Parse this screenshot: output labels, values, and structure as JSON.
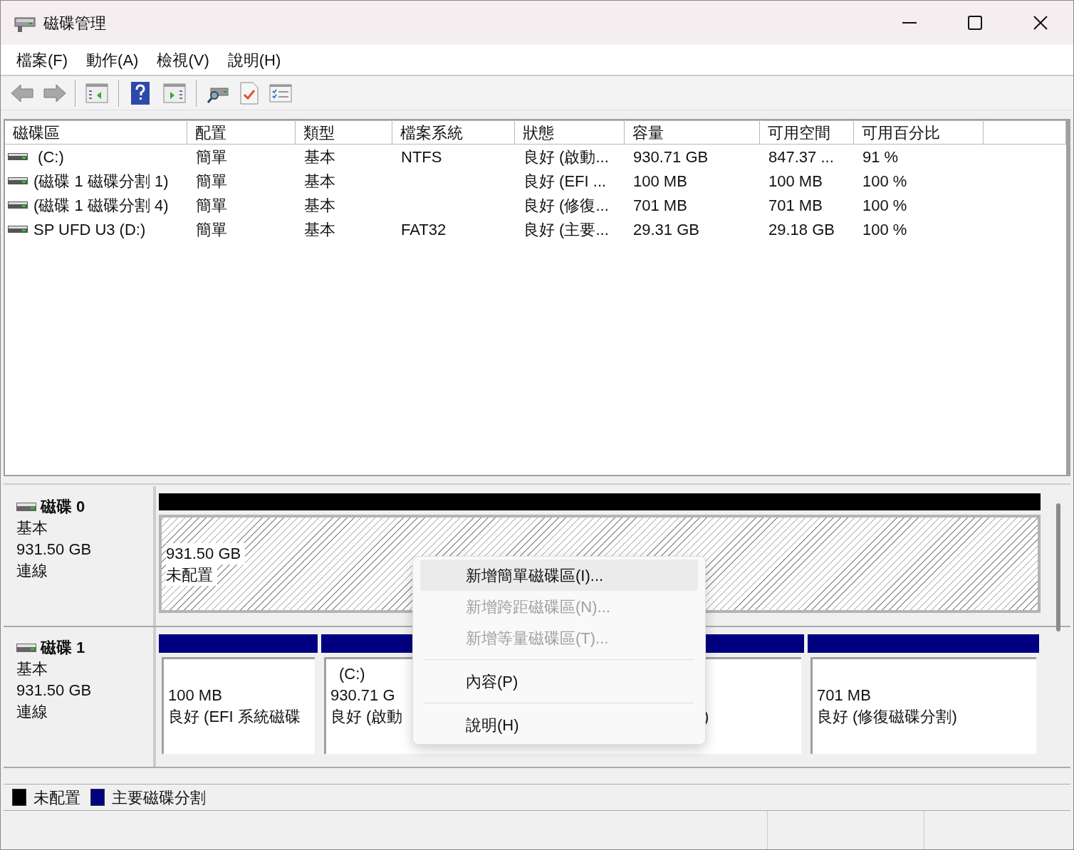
{
  "window": {
    "title": "磁碟管理"
  },
  "menu_bar": [
    "檔案(F)",
    "動作(A)",
    "檢視(V)",
    "說明(H)"
  ],
  "volume_table": {
    "columns": [
      "磁碟區",
      "配置",
      "類型",
      "檔案系統",
      "狀態",
      "容量",
      "可用空間",
      "可用百分比"
    ],
    "rows": [
      {
        "cells": [
          " (C:)",
          "簡單",
          "基本",
          "NTFS",
          "良好 (啟動...",
          "930.71 GB",
          "847.37 ...",
          "91 %"
        ]
      },
      {
        "cells": [
          "(磁碟 1 磁碟分割 1)",
          "簡單",
          "基本",
          "",
          "良好 (EFI ...",
          "100 MB",
          "100 MB",
          "100 %"
        ]
      },
      {
        "cells": [
          "(磁碟 1 磁碟分割 4)",
          "簡單",
          "基本",
          "",
          "良好 (修復...",
          "701 MB",
          "701 MB",
          "100 %"
        ]
      },
      {
        "cells": [
          "SP UFD U3 (D:)",
          "簡單",
          "基本",
          "FAT32",
          "良好 (主要...",
          "29.31 GB",
          "29.18 GB",
          "100 %"
        ]
      }
    ]
  },
  "disks": [
    {
      "name": "磁碟 0",
      "type": "基本",
      "size": "931.50 GB",
      "status": "連線",
      "partitions": [
        {
          "kind": "unallocated",
          "lines": [
            "931.50 GB",
            "未配置"
          ]
        }
      ]
    },
    {
      "name": "磁碟 1",
      "type": "基本",
      "size": "931.50 GB",
      "status": "連線",
      "partitions": [
        {
          "kind": "primary",
          "lines": [
            "100 MB",
            "良好 (EFI 系統磁碟"
          ]
        },
        {
          "kind": "primary",
          "name": "(C:)",
          "lines": [
            "930.71 G",
            "良好 (啟動"
          ],
          "tail": ")"
        },
        {
          "kind": "primary",
          "lines": [
            "701 MB",
            "良好 (修復磁碟分割)"
          ]
        }
      ]
    }
  ],
  "context_menu": {
    "items": [
      {
        "kind": "item",
        "label": "新增簡單磁碟區(I)...",
        "disabled": false,
        "selected": true
      },
      {
        "kind": "item",
        "label": "新增跨距磁碟區(N)...",
        "disabled": true,
        "selected": false
      },
      {
        "kind": "item",
        "label": "新增等量磁碟區(T)...",
        "disabled": true,
        "selected": false
      },
      {
        "kind": "separator"
      },
      {
        "kind": "item",
        "label": "內容(P)",
        "disabled": false,
        "selected": false
      },
      {
        "kind": "separator"
      },
      {
        "kind": "item",
        "label": "說明(H)",
        "disabled": false,
        "selected": false
      }
    ]
  },
  "legend": [
    {
      "label": "未配置",
      "color": "#000000"
    },
    {
      "label": "主要磁碟分割",
      "color": "#000080"
    }
  ]
}
